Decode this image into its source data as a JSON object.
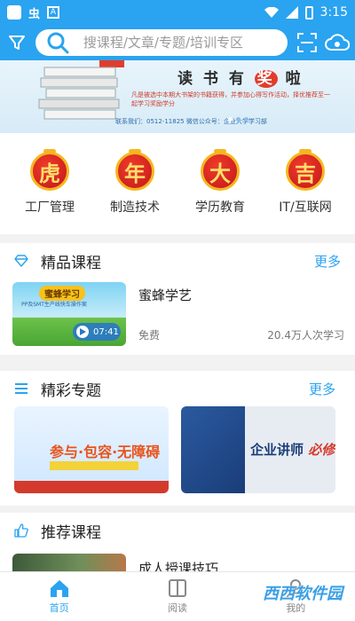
{
  "status_bar": {
    "app_glyph": "虫",
    "a_glyph": "A",
    "time": "3:15"
  },
  "search": {
    "placeholder": "搜课程/文章/专题/培训专区"
  },
  "banner": {
    "title_pre": "读 书 有 ",
    "title_hl": "奖",
    "title_post": " 啦",
    "subtitle": "凡是被选中本期大书架的书籍获得，并参加心得写作活动，择优推荐至一起学习奖励学分",
    "footer": "联系我们：0512-11825     微信公众号：企业大学学习部"
  },
  "categories": [
    {
      "glyph": "虎",
      "label": "工厂管理"
    },
    {
      "glyph": "年",
      "label": "制造技术"
    },
    {
      "glyph": "大",
      "label": "学历教育"
    },
    {
      "glyph": "吉",
      "label": "IT/互联网"
    }
  ],
  "premium": {
    "title": "精品课程",
    "more": "更多",
    "course": {
      "thumb_title": "蜜蜂学习",
      "thumb_sub": "PP及SMT生产线快车操作案",
      "duration": "07:41",
      "name": "蜜蜂学艺",
      "price": "免费",
      "learners": "20.4万人次学习"
    }
  },
  "topics": {
    "title": "精彩专题",
    "more": "更多",
    "items": [
      {
        "text": "参与·包容·无障碍"
      },
      {
        "text": "企业讲师",
        "accent": "必修"
      }
    ]
  },
  "recommend": {
    "title": "推荐课程",
    "course_name": "成人授课技巧"
  },
  "nav": [
    {
      "label": "首页",
      "icon": "home-icon"
    },
    {
      "label": "阅读",
      "icon": "book-icon"
    },
    {
      "label": "我的",
      "icon": "user-icon"
    }
  ],
  "watermark": "西西软件园",
  "colors": {
    "accent": "#2aa3f0",
    "badge_red": "#c4161c",
    "badge_gold": "#f5b71f"
  }
}
